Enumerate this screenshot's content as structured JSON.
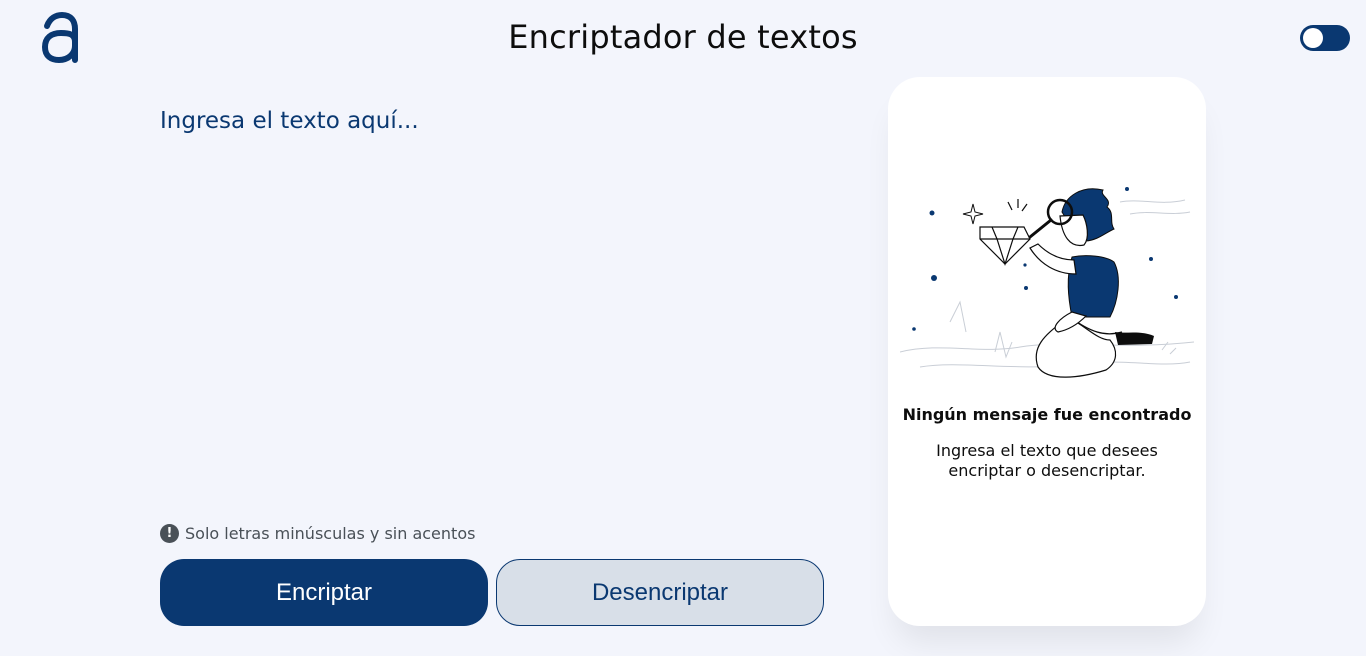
{
  "header": {
    "title": "Encriptador de textos",
    "logo": "alura-logo-icon",
    "theme_toggle": {
      "icon": "dark-mode-toggle",
      "state": "off"
    }
  },
  "input": {
    "placeholder": "Ingresa el texto aquí...",
    "value": ""
  },
  "hint": {
    "icon": "info-icon",
    "glyph": "!",
    "text": "Solo letras minúsculas y sin acentos"
  },
  "buttons": {
    "encrypt_label": "Encriptar",
    "decrypt_label": "Desencriptar"
  },
  "output": {
    "illustration": "person-with-magnifying-glass-illustration",
    "empty_title": "Ningún mensaje fue encontrado",
    "empty_description": "Ingresa el texto que desees encriptar o desencriptar."
  },
  "colors": {
    "background": "#f3f5fc",
    "primary": "#0a3871",
    "secondary_button": "#d8dfe8",
    "hint_gray": "#495057",
    "card": "#ffffff"
  }
}
